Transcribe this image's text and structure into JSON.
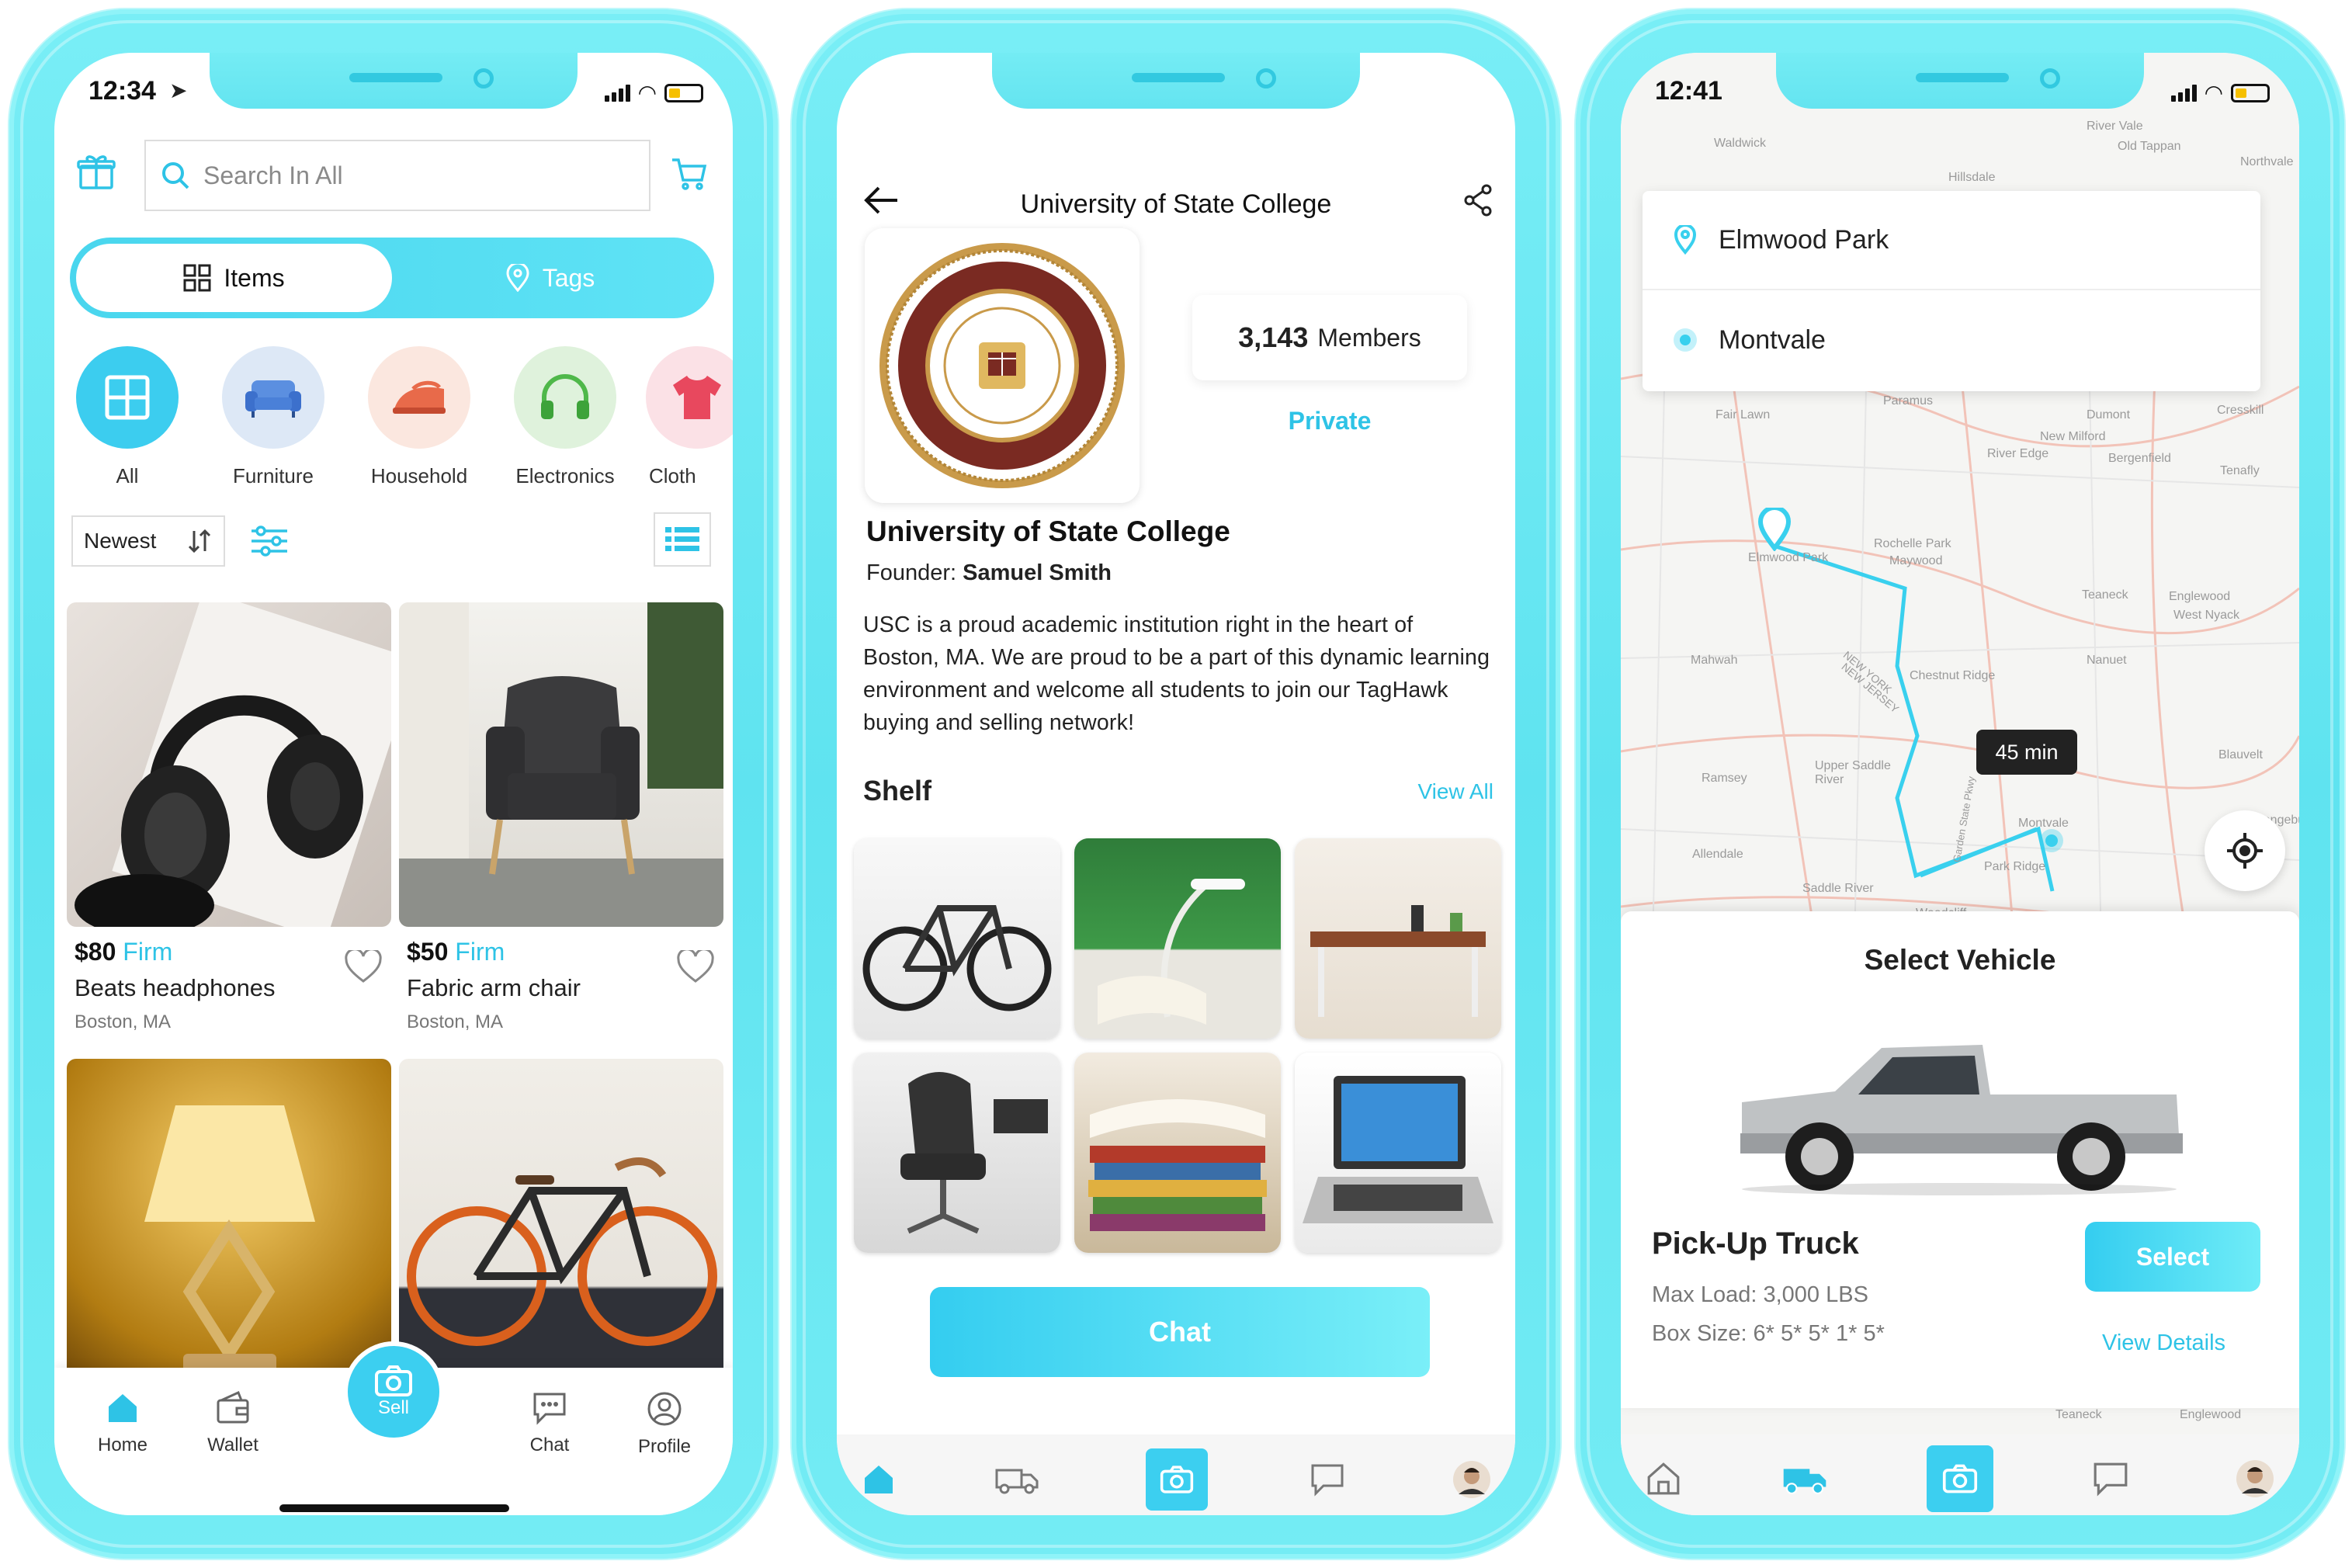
{
  "phone1": {
    "status_time": "12:34",
    "search_placeholder": "Search In All",
    "segments": [
      {
        "label": "Items",
        "active": true
      },
      {
        "label": "Tags",
        "active": false
      }
    ],
    "categories": [
      {
        "label": "All",
        "icon": "grid-icon"
      },
      {
        "label": "Furniture",
        "icon": "sofa-icon"
      },
      {
        "label": "Household",
        "icon": "iron-icon"
      },
      {
        "label": "Electronics",
        "icon": "headphones-icon"
      },
      {
        "label": "Cloth",
        "icon": "shirt-icon"
      }
    ],
    "sort_label": "Newest",
    "products": [
      {
        "price": "$80",
        "tag": "Firm",
        "title": "Beats headphones",
        "location": "Boston, MA"
      },
      {
        "price": "$50",
        "tag": "Firm",
        "title": "Fabric arm chair",
        "location": "Boston, MA"
      },
      {
        "price": "",
        "tag": "",
        "title": "",
        "location": ""
      },
      {
        "price": "",
        "tag": "",
        "title": "",
        "location": ""
      }
    ],
    "tabs": {
      "home": "Home",
      "wallet": "Wallet",
      "sell": "Sell",
      "chat": "Chat",
      "profile": "Profile"
    }
  },
  "phone2": {
    "header_title": "University of State College",
    "members_count": "3,143",
    "members_label": "Members",
    "privacy": "Private",
    "name": "University of State College",
    "founder_label": "Founder:",
    "founder_name": "Samuel Smith",
    "description": "USC is a proud academic institution right in the heart of Boston, MA. We are proud to be a part of this dynamic learning environment and welcome all students to join our TagHawk buying and selling network!",
    "shelf_title": "Shelf",
    "view_all": "View All",
    "chat_button": "Chat"
  },
  "phone3": {
    "status_time": "12:41",
    "origin": "Elmwood Park",
    "destination": "Montvale",
    "eta": "45 min",
    "vehicle_header": "Select Vehicle",
    "vehicle_name": "Pick-Up Truck",
    "max_load": "Max Load: 3,000 LBS",
    "box_size": "Box Size: 6* 5* 5* 1* 5*",
    "select_button": "Select",
    "view_details": "View Details",
    "map_labels": [
      "Waldwick",
      "River Vale",
      "Old Tappan",
      "Northvale",
      "Hillsdale",
      "Fair Lawn",
      "Paramus",
      "Dumont",
      "Cresskill",
      "New Milford",
      "Bergenfield",
      "Tenafly",
      "River Edge",
      "Elmwood Park",
      "Rochelle Park",
      "Maywood",
      "Teaneck",
      "Englewood",
      "West Nyack",
      "Mahwah",
      "Chestnut Ridge",
      "Nanuet",
      "Upper Saddle River",
      "Ramsey",
      "Blauvelt",
      "Allendale",
      "Park Ridge",
      "Saddle River",
      "Woodcliff",
      "Montvale",
      "Orangeburg",
      "NEW YORK",
      "NEW JERSEY",
      "Garden State Pkwy",
      "Englewood",
      "Teaneck"
    ]
  },
  "colors": {
    "accent": "#2ec3e6",
    "frame": "#6ae8f3"
  }
}
